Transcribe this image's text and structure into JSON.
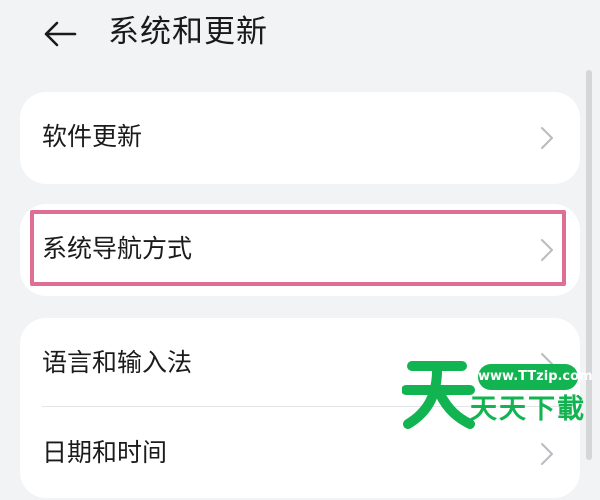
{
  "header": {
    "title": "系统和更新",
    "back_icon": "back-arrow-icon"
  },
  "cards": [
    {
      "items": [
        {
          "label": "软件更新",
          "icon": "chevron-right-icon"
        }
      ]
    },
    {
      "items": [
        {
          "label": "系统导航方式",
          "icon": "chevron-right-icon"
        }
      ]
    },
    {
      "items": [
        {
          "label": "语言和输入法",
          "icon": "chevron-right-icon"
        },
        {
          "label": "日期和时间",
          "icon": "chevron-right-icon"
        }
      ]
    }
  ],
  "highlight_color": "#de6e92",
  "watermark": {
    "url": "www.TTzip.com",
    "text": "天天下載",
    "color": "#12b351"
  }
}
